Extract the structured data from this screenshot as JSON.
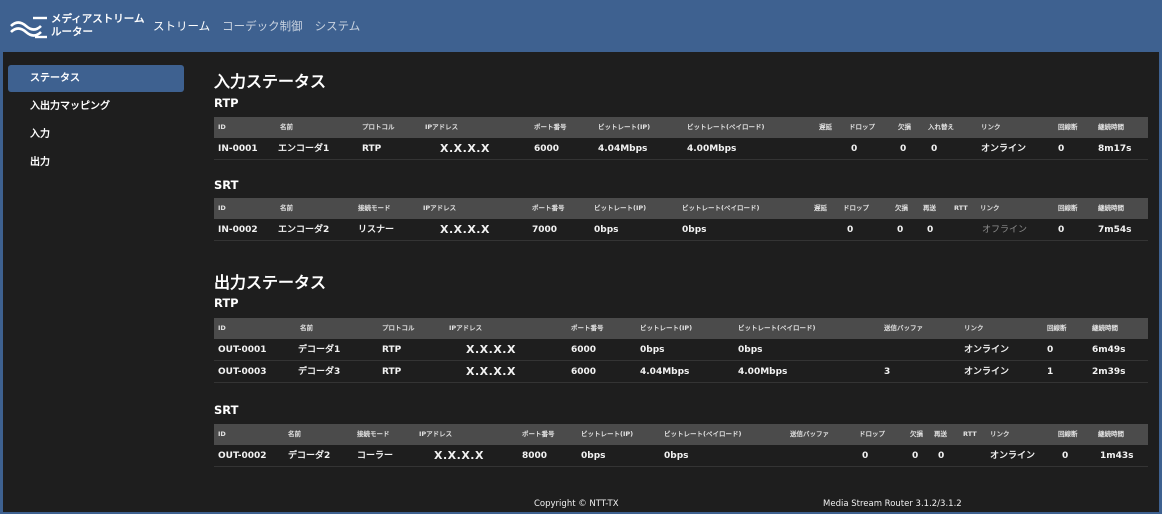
{
  "app": {
    "brand_line1": "メディアストリーム",
    "brand_line2": "ルーター",
    "accent_color": "#3e6190"
  },
  "nav": [
    "ストリーム",
    "コーデック制御",
    "システム"
  ],
  "sidebar": [
    "ステータス",
    "入出力マッピング",
    "入力",
    "出力"
  ],
  "input_status": {
    "title": "入力ステータス",
    "rtp": {
      "label": "RTP",
      "headers": [
        "ID",
        "名前",
        "プロトコル",
        "IPアドレス",
        "ポート番号",
        "ビットレート(IP)",
        "ビットレート(ペイロード)",
        "遅延",
        "ドロップ",
        "欠損",
        "入れ替え",
        "リンク",
        "回線断",
        "継続時間"
      ],
      "rows": [
        [
          "IN-0001",
          "エンコーダ1",
          "RTP",
          "X.X.X.X",
          "6000",
          "4.04Mbps",
          "4.00Mbps",
          "",
          "0",
          "0",
          "0",
          "オンライン",
          "0",
          "8m17s"
        ]
      ]
    },
    "srt": {
      "label": "SRT",
      "headers": [
        "ID",
        "名前",
        "接続モード",
        "IPアドレス",
        "ポート番号",
        "ビットレート(IP)",
        "ビットレート(ペイロード)",
        "遅延",
        "ドロップ",
        "欠損",
        "再送",
        "RTT",
        "リンク",
        "回線断",
        "継続時間"
      ],
      "rows": [
        [
          "IN-0002",
          "エンコーダ2",
          "リスナー",
          "X.X.X.X",
          "7000",
          "0bps",
          "0bps",
          "",
          "0",
          "0",
          "0",
          "",
          "オフライン",
          "0",
          "7m54s"
        ]
      ]
    }
  },
  "output_status": {
    "title": "出力ステータス",
    "rtp": {
      "label": "RTP",
      "headers": [
        "ID",
        "名前",
        "プロトコル",
        "IPアドレス",
        "ポート番号",
        "ビットレート(IP)",
        "ビットレート(ペイロード)",
        "送信バッファ",
        "リンク",
        "回線断",
        "継続時間"
      ],
      "rows": [
        [
          "OUT-0001",
          "デコーダ1",
          "RTP",
          "X.X.X.X",
          "6000",
          "0bps",
          "0bps",
          "",
          "オンライン",
          "0",
          "6m49s"
        ],
        [
          "OUT-0003",
          "デコーダ3",
          "RTP",
          "X.X.X.X",
          "6000",
          "4.04Mbps",
          "4.00Mbps",
          "3",
          "オンライン",
          "1",
          "2m39s"
        ]
      ]
    },
    "srt": {
      "label": "SRT",
      "headers": [
        "ID",
        "名前",
        "接続モード",
        "IPアドレス",
        "ポート番号",
        "ビットレート(IP)",
        "ビットレート(ペイロード)",
        "送信バッファ",
        "ドロップ",
        "欠損",
        "再送",
        "RTT",
        "リンク",
        "回線断",
        "継続時間"
      ],
      "rows": [
        [
          "OUT-0002",
          "デコーダ2",
          "コーラー",
          "X.X.X.X",
          "8000",
          "0bps",
          "0bps",
          "",
          "0",
          "0",
          "0",
          "",
          "オンライン",
          "0",
          "1m43s"
        ]
      ]
    }
  },
  "footer": {
    "copyright": "Copyright © NTT-TX",
    "version": "Media Stream Router  3.1.2/3.1.2"
  }
}
